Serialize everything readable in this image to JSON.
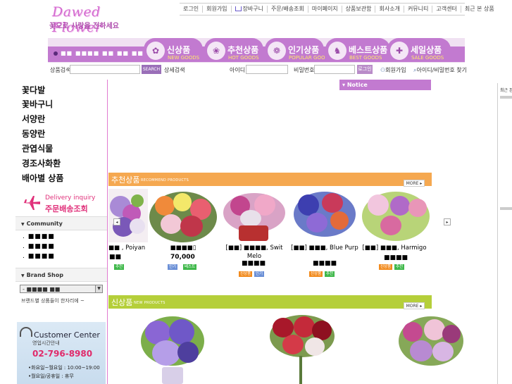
{
  "logo": {
    "script": "Dawed Flower",
    "tagline": "꽃으로 사랑을 전하세요"
  },
  "topnav": {
    "items": [
      "로그인",
      "회원가입",
      "장바구니",
      "주문/배송조회",
      "마이페이지",
      "상품보관함",
      "회사소개",
      "커뮤니티",
      "고객센터",
      "최근 본 상품"
    ]
  },
  "mainmenu": {
    "left_text": "■■ ■■■■ ■■ ■■ ■■■■",
    "tabs": [
      {
        "kr": "신상품",
        "en": "NEW GOODS",
        "icon": "star-icon"
      },
      {
        "kr": "추천상품",
        "en": "HOT GOODS",
        "icon": "flower-icon"
      },
      {
        "kr": "인기상품",
        "en": "POPULAR GOODS",
        "icon": "flower-icon"
      },
      {
        "kr": "베스트상품",
        "en": "BEST GOODS",
        "icon": "rabbit-icon"
      },
      {
        "kr": "세일상품",
        "en": "SALE GOODS",
        "icon": "sale-icon"
      }
    ]
  },
  "searchbar": {
    "label": "상품검색",
    "search_btn": "SEARCH",
    "detail": "상세검색",
    "id_label": "아이디",
    "pw_label": "비밀번호",
    "login_btn": "로그인",
    "join": "회원가입",
    "find": "아이디/비밀번호 찾기"
  },
  "sidebar": {
    "categories": [
      "꽃다발",
      "꽃바구니",
      "서양란",
      "동양란",
      "관엽식물",
      "경조사화환",
      "배아별 상품"
    ],
    "delivery_en": "Delivery inquiry",
    "delivery_kr": "주문배송조회",
    "community_title": "Community",
    "community_items": [
      ". ■■■■",
      ". ■■■■",
      ". ■■■■"
    ],
    "brand_title": "Brand Shop",
    "brand_select": "- ■■■■ ■■",
    "brand_note": "브랜드별 상품들이 한자리에 ~",
    "customer": {
      "title": "Customer Center",
      "sub": "영업시간안내",
      "phone": "02-796-8980",
      "hours1": "•화요일~월요일 : 10:00~19:00",
      "hours2": "•월요일/공휴일 : 휴무"
    }
  },
  "notice": {
    "label": "Notice"
  },
  "recommend": {
    "title_kr": "추천상품",
    "title_en": "RECOMMEND PRODUCTS",
    "more": "MORE",
    "products": [
      {
        "title": "■■ , Poiyan",
        "price": "■■",
        "tags": [
          "추천"
        ]
      },
      {
        "title": "■■■■▯",
        "price": "70,000",
        "tags": [
          "인기",
          "베스트"
        ]
      },
      {
        "title": "[■■] ■■■■, Swit Melo",
        "price": "■■■■",
        "tags": [
          "신상품",
          "인기"
        ]
      },
      {
        "title": "[■■] ■■■, Blue Purp",
        "price": "■■■■",
        "tags": [
          "신상품",
          "추천"
        ]
      },
      {
        "title": "[■■] ■■■, Harmigo",
        "price": "■■■■",
        "tags": [
          "신상품",
          "추천"
        ]
      }
    ]
  },
  "newproducts": {
    "title_kr": "신상품",
    "title_en": "NEW PRODUCTS",
    "more": "MORE"
  },
  "recent": {
    "label": "최근 본"
  },
  "colors": {
    "accent": "#c27ad0",
    "orange": "#f5a850",
    "olive": "#b5cf3a"
  }
}
